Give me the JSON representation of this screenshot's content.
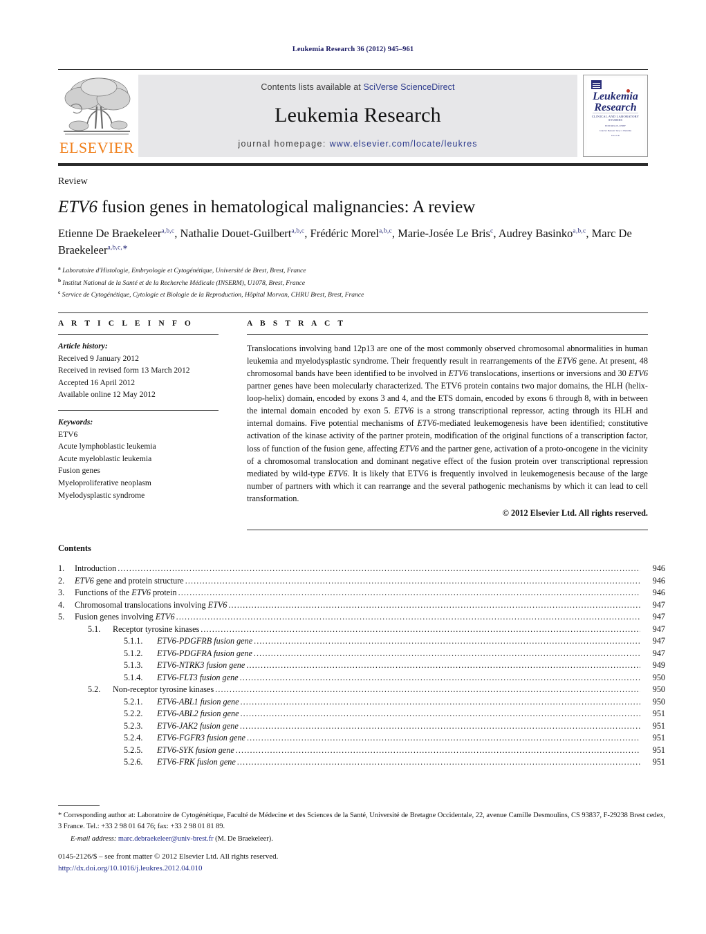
{
  "running_head": "Leukemia Research 36 (2012) 945–961",
  "masthead": {
    "publisher_name": "ELSEVIER",
    "contents_prefix": "Contents lists available at ",
    "sciencedirect": "SciVerse ScienceDirect",
    "journal_title": "Leukemia Research",
    "homepage_prefix": "journal homepage: ",
    "homepage_url": "www.elsevier.com/locate/leukres",
    "cover": {
      "line1": "Leukemia",
      "line2": "Research",
      "subtitle": "CLINICAL AND LABORATORY STUDIES",
      "meta1": "EDITORS-IN-CHIEF",
      "meta2": "John M. Bennett       Terry J. Hamblin",
      "meta3": "USA                            UK"
    }
  },
  "article": {
    "type_label": "Review",
    "title_italic": "ETV6",
    "title_rest": " fusion genes in hematological malignancies: A review",
    "authors": [
      {
        "name": "Etienne De Braekeleer",
        "sup": "a,b,c",
        "sep": ", "
      },
      {
        "name": "Nathalie Douet-Guilbert",
        "sup": "a,b,c",
        "sep": ", "
      },
      {
        "name": "Frédéric Morel",
        "sup": "a,b,c",
        "sep": ", "
      },
      {
        "name": "Marie-Josée Le Bris",
        "sup": "c",
        "sep": ", "
      },
      {
        "name": "Audrey Basinko",
        "sup": "a,b,c",
        "sep": ", "
      },
      {
        "name": "Marc De Braekeleer",
        "sup": "a,b,c,∗",
        "sep": ""
      }
    ],
    "affiliations": [
      {
        "mark": "a",
        "text": "Laboratoire d'Histologie, Embryologie et Cytogénétique, Université de Brest, Brest, France"
      },
      {
        "mark": "b",
        "text": "Institut National de la Santé et de la Recherche Médicale (INSERM), U1078, Brest, France"
      },
      {
        "mark": "c",
        "text": "Service de Cytogénétique, Cytologie et Biologie de la Reproduction, Hôpital Morvan, CHRU Brest, Brest, France"
      }
    ]
  },
  "article_info": {
    "heading": "A R T I C L E   I N F O",
    "history_label": "Article history:",
    "history": [
      "Received 9 January 2012",
      "Received in revised form 13 March 2012",
      "Accepted 16 April 2012",
      "Available online 12 May 2012"
    ],
    "keywords_label": "Keywords:",
    "keywords": [
      "ETV6",
      "Acute lymphoblastic leukemia",
      "Acute myeloblastic leukemia",
      "Fusion genes",
      "Myeloproliferative neoplasm",
      "Myelodysplastic syndrome"
    ]
  },
  "abstract": {
    "heading": "A B S T R A C T",
    "paragraphs": [
      "Translocations involving band 12p13 are one of the most commonly observed chromosomal abnormalities in human leukemia and myelodysplastic syndrome. Their frequently result in rearrangements of the <i>ETV6</i> gene. At present, 48 chromosomal bands have been identified to be involved in <i>ETV6</i> translocations, insertions or inversions and 30 <i>ETV6</i> partner genes have been molecularly characterized. The ETV6 protein contains two major domains, the HLH (helix-loop-helix) domain, encoded by exons 3 and 4, and the ETS domain, encoded by exons 6 through 8, with in between the internal domain encoded by exon 5. <i>ETV6</i> is a strong transcriptional repressor, acting through its HLH and internal domains. Five potential mechanisms of <i>ETV6</i>-mediated leukemogenesis have been identified; constitutive activation of the kinase activity of the partner protein, modification of the original functions of a transcription factor, loss of function of the fusion gene, affecting <i>ETV6</i> and the partner gene, activation of a proto-oncogene in the vicinity of a chromosomal translocation and dominant negative effect of the fusion protein over transcriptional repression mediated by wild-type <i>ETV6</i>. It is likely that ETV6 is frequently involved in leukemogenesis because of the large number of partners with which it can rearrange and the several pathogenic mechanisms by which it can lead to cell transformation."
    ],
    "copyright": "© 2012 Elsevier Ltd. All rights reserved."
  },
  "contents": {
    "heading": "Contents",
    "entries": [
      {
        "level": 1,
        "num": "1.",
        "label_pre": "Introduction",
        "label_italic": "",
        "label_post": "",
        "page": "946"
      },
      {
        "level": 1,
        "num": "2.",
        "label_pre": "",
        "label_italic": "ETV6",
        "label_post": " gene and protein structure",
        "page": "946"
      },
      {
        "level": 1,
        "num": "3.",
        "label_pre": "Functions of the ",
        "label_italic": "ETV6",
        "label_post": " protein",
        "page": "946"
      },
      {
        "level": 1,
        "num": "4.",
        "label_pre": "Chromosomal translocations involving ",
        "label_italic": "ETV6",
        "label_post": "",
        "page": "947"
      },
      {
        "level": 1,
        "num": "5.",
        "label_pre": "Fusion genes involving ",
        "label_italic": "ETV6",
        "label_post": "",
        "page": "947"
      },
      {
        "level": 2,
        "num": "5.1.",
        "label_pre": "Receptor tyrosine kinases",
        "label_italic": "",
        "label_post": "",
        "page": "947"
      },
      {
        "level": 3,
        "num": "5.1.1.",
        "label_pre": "",
        "label_italic": "ETV6-PDGFRB",
        "label_post": " fusion gene",
        "page": "947"
      },
      {
        "level": 3,
        "num": "5.1.2.",
        "label_pre": "",
        "label_italic": "ETV6-PDGFRA",
        "label_post": " fusion gene",
        "page": "947"
      },
      {
        "level": 3,
        "num": "5.1.3.",
        "label_pre": "",
        "label_italic": "ETV6-NTRK3",
        "label_post": " fusion gene",
        "page": "949"
      },
      {
        "level": 3,
        "num": "5.1.4.",
        "label_pre": "",
        "label_italic": "ETV6-FLT3",
        "label_post": " fusion gene",
        "page": "950"
      },
      {
        "level": 2,
        "num": "5.2.",
        "label_pre": "Non-receptor tyrosine kinases",
        "label_italic": "",
        "label_post": "",
        "page": "950"
      },
      {
        "level": 3,
        "num": "5.2.1.",
        "label_pre": "",
        "label_italic": "ETV6-ABL1",
        "label_post": " fusion gene",
        "page": "950"
      },
      {
        "level": 3,
        "num": "5.2.2.",
        "label_pre": "",
        "label_italic": "ETV6-ABL2",
        "label_post": " fusion gene",
        "page": "951"
      },
      {
        "level": 3,
        "num": "5.2.3.",
        "label_pre": "",
        "label_italic": "ETV6-JAK2",
        "label_post": " fusion gene",
        "page": "951"
      },
      {
        "level": 3,
        "num": "5.2.4.",
        "label_pre": "",
        "label_italic": "ETV6-FGFR3",
        "label_post": " fusion gene",
        "page": "951"
      },
      {
        "level": 3,
        "num": "5.2.5.",
        "label_pre": "",
        "label_italic": "ETV6-SYK",
        "label_post": " fusion gene",
        "page": "951"
      },
      {
        "level": 3,
        "num": "5.2.6.",
        "label_pre": "",
        "label_italic": "ETV6-FRK",
        "label_post": " fusion gene",
        "page": "951"
      }
    ]
  },
  "footnotes": {
    "corresponding": "* Corresponding author at: Laboratoire de Cytogénétique, Faculté de Médecine et des Sciences de la Santé, Université de Bretagne Occidentale, 22, avenue Camille Desmoulins, CS 93837, F-29238 Brest cedex, 3 France. Tel.: +33 2 98 01 64 76; fax: +33 2 98 01 81 89.",
    "email_label": "E-mail address:",
    "email": "marc.debraekeleer@univ-brest.fr",
    "email_suffix": " (M. De Braekeleer).",
    "issn_line": "0145-2126/$ – see front matter © 2012 Elsevier Ltd. All rights reserved.",
    "doi": "http://dx.doi.org/10.1016/j.leukres.2012.04.010"
  },
  "colors": {
    "link_blue": "#1f2a8a",
    "elsevier_orange": "#F07F1A",
    "banner_grey": "#e7e7e9",
    "rule_dark": "#2b2b2b"
  }
}
